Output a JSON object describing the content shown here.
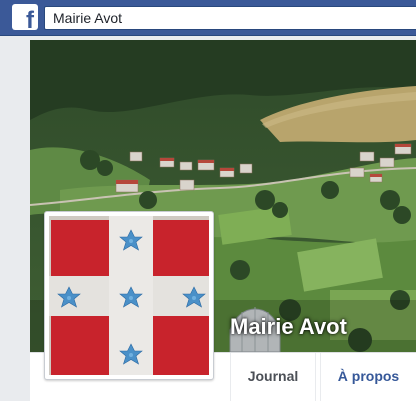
{
  "topbar": {
    "logo_glyph": "f",
    "search_value": "Mairie Avot"
  },
  "page": {
    "name": "Mairie Avot"
  },
  "tabs": [
    {
      "label": "Journal",
      "active": true
    },
    {
      "label": "À propos",
      "active": false
    }
  ],
  "colors": {
    "brand_blue": "#3b5998",
    "flag_red": "#c8232c",
    "flag_cross": "#e6e6e6",
    "star_blue": "#4a90c8"
  },
  "icons": {
    "logo": "facebook-logo-icon",
    "stars": "blue-star-icon"
  }
}
